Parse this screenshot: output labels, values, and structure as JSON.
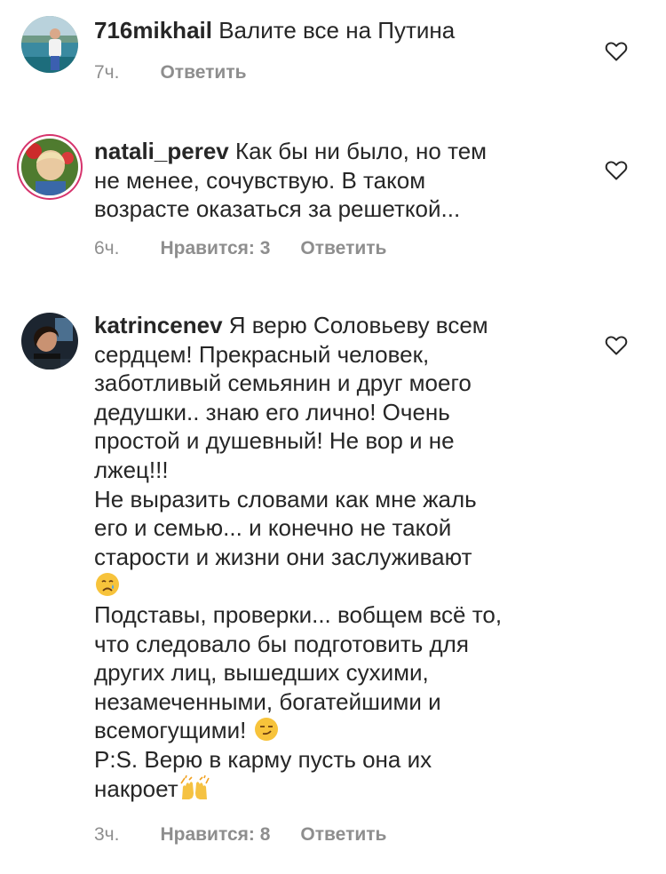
{
  "comments": [
    {
      "username": "716mikhail",
      "lines": [
        "Валите все на Путина"
      ],
      "time": "7ч.",
      "likes": "",
      "reply": "Ответить"
    },
    {
      "username": "natali_perev",
      "lines": [
        "Как бы ни было, но тем",
        "не менее, сочувствую. В таком",
        "возрасте оказаться за решеткой..."
      ],
      "time": "6ч.",
      "likes": "Нравится: 3",
      "reply": "Ответить"
    },
    {
      "username": "katrincenev",
      "lines": [
        "Я верю Соловьеву всем",
        "сердцем! Прекрасный человек,",
        "заботливый семьянин и друг моего",
        "дедушки.. знаю его лично! Очень",
        "простой и душевный! Не вор и не",
        "лжец!!!",
        "Не выразить словами как мне жаль",
        "его и семью... и конечно не такой",
        "старости и жизни они заслуживают",
        "",
        "Подставы, проверки... вобщем всё то,",
        "что следовало бы подготовить для",
        "других лиц, вышедших сухими,",
        "незамеченными, богатейшими и",
        "всемогущими!",
        "P:S. Верю в карму пусть она их",
        "накроет"
      ],
      "emojis": [
        "crying-face",
        "smirking-face",
        "raising-hands"
      ],
      "time": "3ч.",
      "likes": "Нравится: 8",
      "reply": "Ответить"
    }
  ],
  "colors": {
    "text": "#262626",
    "meta": "#8e8e8e",
    "story_ring": "#d6336c"
  },
  "icons": [
    "heart-outline-icon"
  ]
}
